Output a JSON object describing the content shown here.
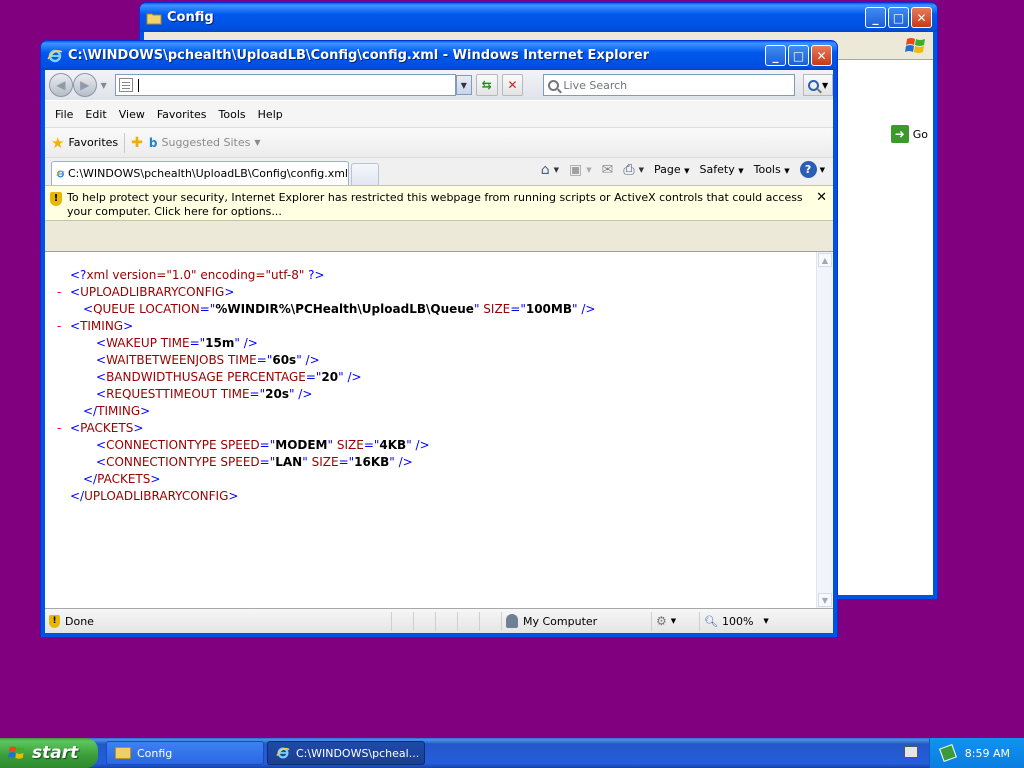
{
  "back_window": {
    "title": "Config",
    "go_label": "Go"
  },
  "ie_window": {
    "title": "C:\\WINDOWS\\pchealth\\UploadLB\\Config\\config.xml - Windows Internet Explorer",
    "address_value": "",
    "search_placeholder": "Live Search",
    "menu": [
      "File",
      "Edit",
      "View",
      "Favorites",
      "Tools",
      "Help"
    ],
    "favorites_label": "Favorites",
    "suggested_sites_label": "Suggested Sites",
    "tab_title": "C:\\WINDOWS\\pchealth\\UploadLB\\Config\\config.xml",
    "page_menu": "Page",
    "safety_menu": "Safety",
    "tools_menu": "Tools",
    "infobar_text": "To help protect your security, Internet Explorer has restricted this webpage from running scripts or ActiveX controls that could access your computer. Click here for options...",
    "status_text": "Done",
    "zone_text": "My Computer",
    "zoom_text": "100%"
  },
  "xml_lines": [
    {
      "indent": 1,
      "minus": false,
      "html": "<span class=\"blue\">&lt;?</span><span class=\"tag\">xml version=\"1.0\" encoding=\"utf-8\"</span><span class=\"blue\"> ?&gt;</span>"
    },
    {
      "indent": 0,
      "minus": true,
      "html": "<span class=\"blue\">&lt;</span><span class=\"tag\">UPLOADLIBRARYCONFIG</span><span class=\"blue\">&gt;</span>"
    },
    {
      "indent": 2,
      "minus": false,
      "html": "<span class=\"blue\">&lt;</span><span class=\"tag\">QUEUE</span> <span class=\"attr\">LOCATION</span><span class=\"blue\">=\"</span><span class=\"val\">%WINDIR%\\PCHealth\\UploadLB\\Queue</span><span class=\"blue\">\"</span> <span class=\"attr\">SIZE</span><span class=\"blue\">=\"</span><span class=\"val\">100MB</span><span class=\"blue\">\" /&gt;</span>"
    },
    {
      "indent": 1,
      "minus": true,
      "html": "<span class=\"blue\">&lt;</span><span class=\"tag\">TIMING</span><span class=\"blue\">&gt;</span>"
    },
    {
      "indent": 3,
      "minus": false,
      "html": "<span class=\"blue\">&lt;</span><span class=\"tag\">WAKEUP</span> <span class=\"attr\">TIME</span><span class=\"blue\">=\"</span><span class=\"val\">15m</span><span class=\"blue\">\" /&gt;</span>"
    },
    {
      "indent": 3,
      "minus": false,
      "html": "<span class=\"blue\">&lt;</span><span class=\"tag\">WAITBETWEENJOBS</span> <span class=\"attr\">TIME</span><span class=\"blue\">=\"</span><span class=\"val\">60s</span><span class=\"blue\">\" /&gt;</span>"
    },
    {
      "indent": 3,
      "minus": false,
      "html": "<span class=\"blue\">&lt;</span><span class=\"tag\">BANDWIDTHUSAGE</span> <span class=\"attr\">PERCENTAGE</span><span class=\"blue\">=\"</span><span class=\"val\">20</span><span class=\"blue\">\" /&gt;</span>"
    },
    {
      "indent": 3,
      "minus": false,
      "html": "<span class=\"blue\">&lt;</span><span class=\"tag\">REQUESTTIMEOUT</span> <span class=\"attr\">TIME</span><span class=\"blue\">=\"</span><span class=\"val\">20s</span><span class=\"blue\">\" /&gt;</span>"
    },
    {
      "indent": 2,
      "minus": false,
      "html": "<span class=\"blue\">&lt;/</span><span class=\"tag\">TIMING</span><span class=\"blue\">&gt;</span>"
    },
    {
      "indent": 1,
      "minus": true,
      "html": "<span class=\"blue\">&lt;</span><span class=\"tag\">PACKETS</span><span class=\"blue\">&gt;</span>"
    },
    {
      "indent": 3,
      "minus": false,
      "html": "<span class=\"blue\">&lt;</span><span class=\"tag\">CONNECTIONTYPE</span> <span class=\"attr\">SPEED</span><span class=\"blue\">=\"</span><span class=\"val\">MODEM</span><span class=\"blue\">\"</span> <span class=\"attr\">SIZE</span><span class=\"blue\">=\"</span><span class=\"val\">4KB</span><span class=\"blue\">\" /&gt;</span>"
    },
    {
      "indent": 3,
      "minus": false,
      "html": "<span class=\"blue\">&lt;</span><span class=\"tag\">CONNECTIONTYPE</span> <span class=\"attr\">SPEED</span><span class=\"blue\">=\"</span><span class=\"val\">LAN</span><span class=\"blue\">\"</span> <span class=\"attr\">SIZE</span><span class=\"blue\">=\"</span><span class=\"val\">16KB</span><span class=\"blue\">\" /&gt;</span>"
    },
    {
      "indent": 2,
      "minus": false,
      "html": "<span class=\"blue\">&lt;/</span><span class=\"tag\">PACKETS</span><span class=\"blue\">&gt;</span>"
    },
    {
      "indent": 1,
      "minus": false,
      "html": "<span class=\"blue\">&lt;/</span><span class=\"tag\">UPLOADLIBRARYCONFIG</span><span class=\"blue\">&gt;</span>"
    }
  ],
  "taskbar": {
    "start_label": "start",
    "tasks": [
      "Config",
      "C:\\WINDOWS\\pcheal..."
    ],
    "clock": "8:59 AM"
  },
  "colors": {
    "desktop": "#800080",
    "xml_markup": "#0000ff",
    "xml_tag": "#990000",
    "collapse_minus": "#ff0000"
  }
}
